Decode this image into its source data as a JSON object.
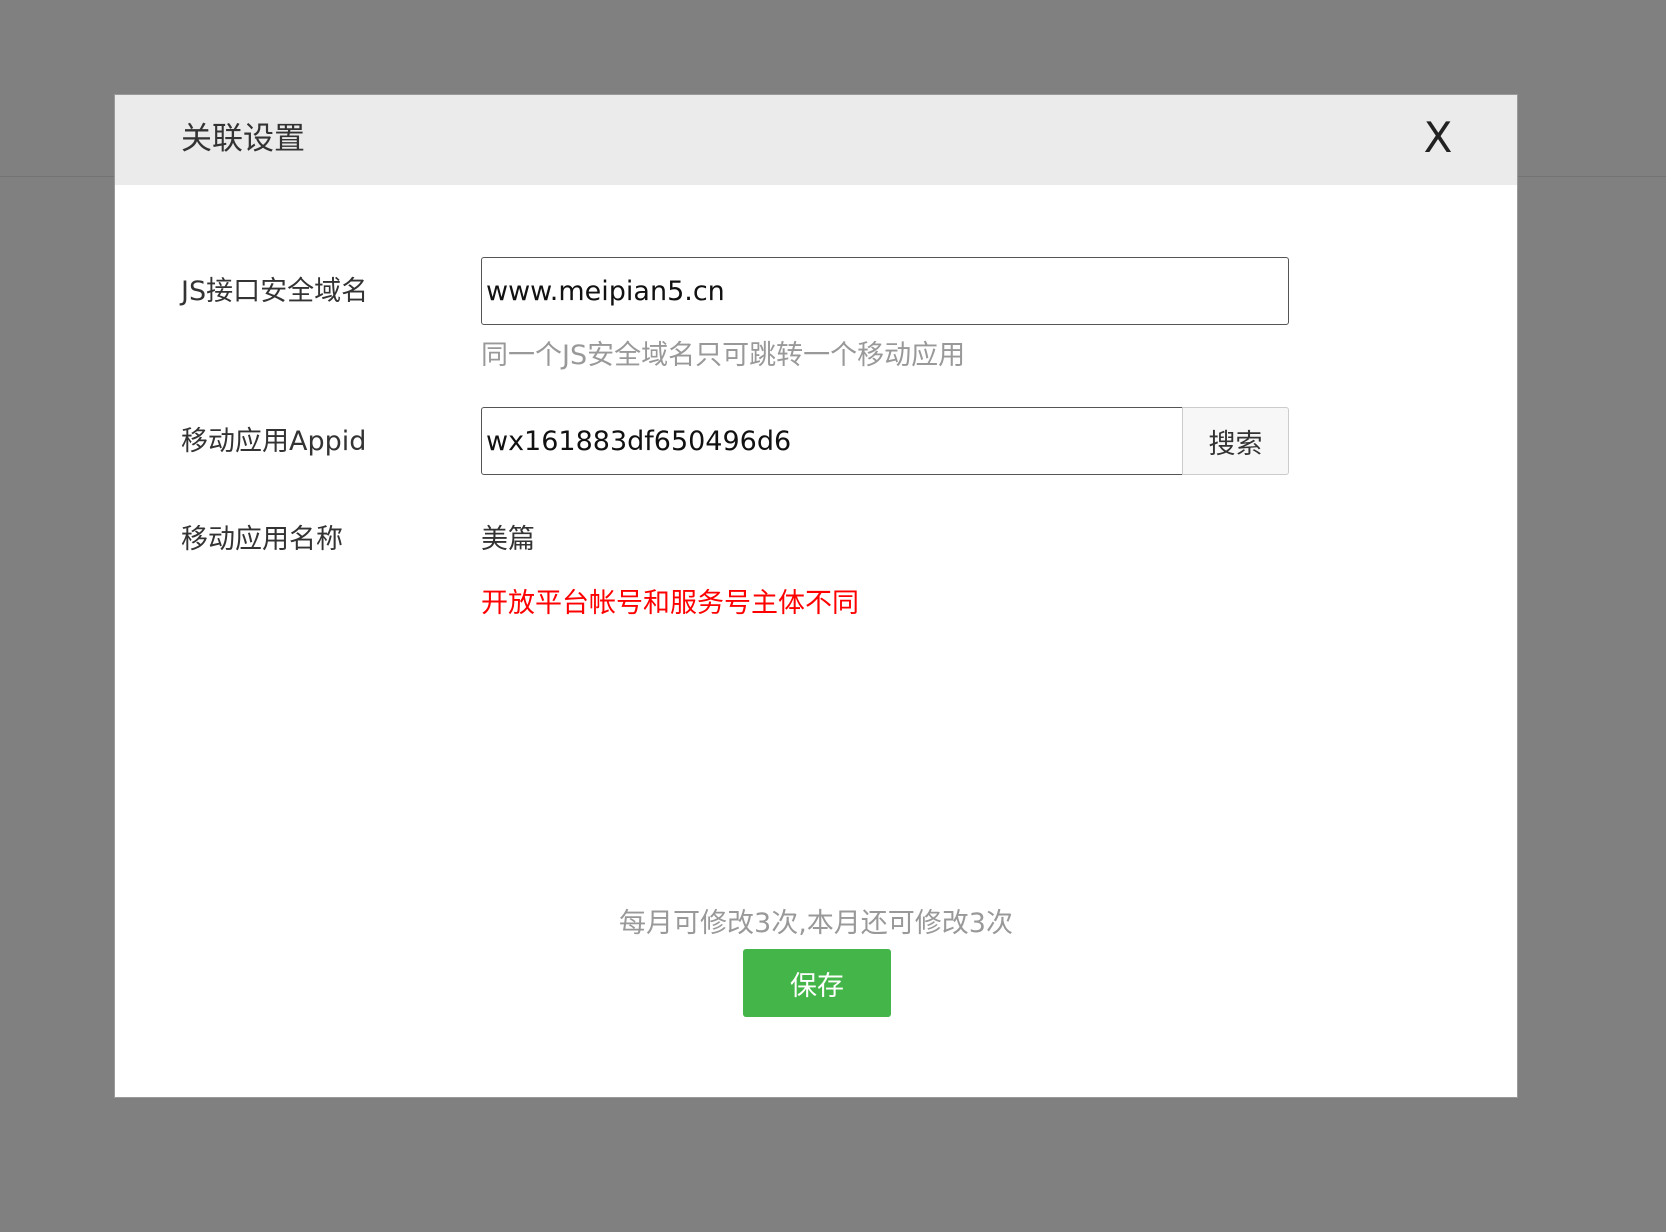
{
  "dialog": {
    "title": "关联设置",
    "close_label": "X"
  },
  "form": {
    "js_domain": {
      "label": "JS接口安全域名",
      "value": "www.meipian5.cn",
      "hint": "同一个JS安全域名只可跳转一个移动应用"
    },
    "appid": {
      "label": "移动应用Appid",
      "value": "wx161883df650496d6",
      "search_label": "搜索"
    },
    "app_name": {
      "label": "移动应用名称",
      "value": "美篇",
      "error": "开放平台帐号和服务号主体不同"
    }
  },
  "footer": {
    "quota_note": "每月可修改3次,本月还可修改3次",
    "save_label": "保存"
  },
  "colors": {
    "backdrop": "#808080",
    "header_bg": "#ebebeb",
    "save_button": "#44b549",
    "error_text": "#ff0000",
    "hint_text": "#999999"
  }
}
